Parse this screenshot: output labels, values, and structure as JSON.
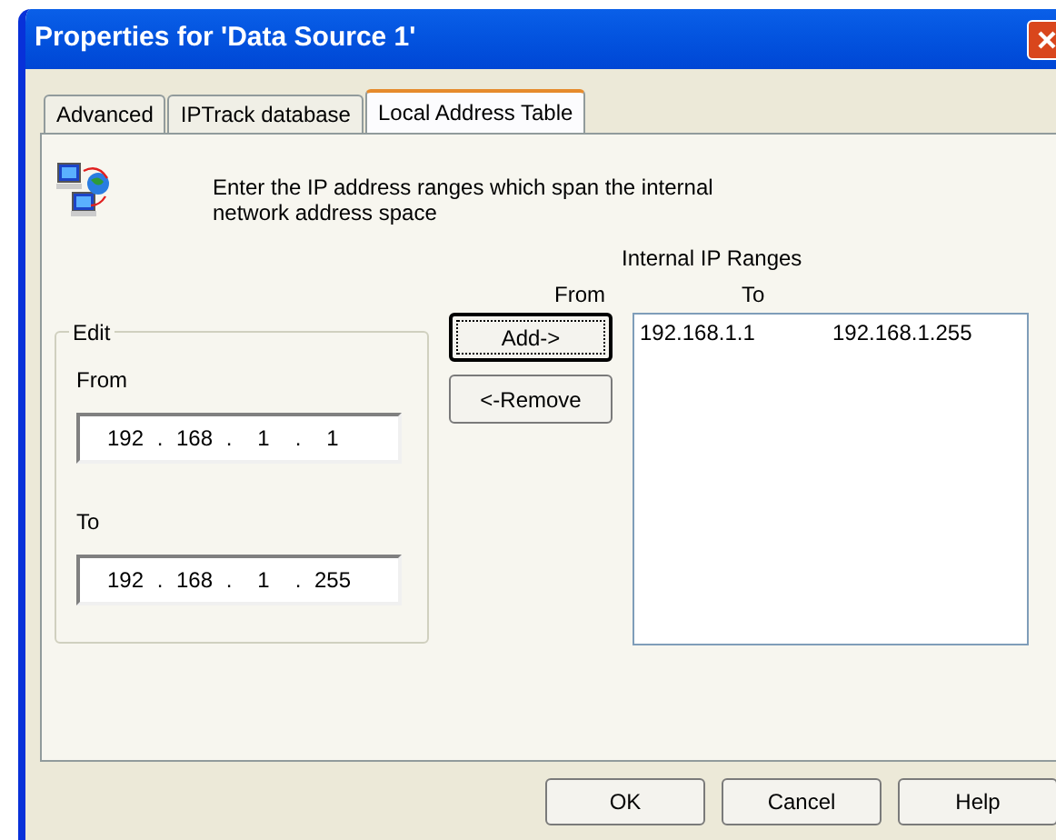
{
  "window": {
    "title": "Properties for 'Data Source 1'"
  },
  "tabs": [
    {
      "label": "Advanced",
      "selected": false
    },
    {
      "label": "IPTrack database",
      "selected": false
    },
    {
      "label": "Local Address Table",
      "selected": true
    }
  ],
  "description": "Enter the IP address ranges which span the internal network address space",
  "edit_group": {
    "title": "Edit",
    "fields": [
      {
        "label": "From",
        "octets": [
          "192",
          "168",
          "1",
          "1"
        ]
      },
      {
        "label": "To",
        "octets": [
          "192",
          "168",
          "1",
          "255"
        ]
      }
    ],
    "separator": "."
  },
  "buttons": [
    {
      "label": "Add->",
      "focused": true
    },
    {
      "label": "<-Remove",
      "focused": false
    }
  ],
  "ranges": {
    "title": "Internal IP Ranges",
    "columns": [
      "From",
      "To"
    ],
    "rows": [
      [
        "192.168.1.1",
        "192.168.1.255"
      ]
    ]
  },
  "footer_buttons": [
    "OK",
    "Cancel",
    "Help"
  ]
}
